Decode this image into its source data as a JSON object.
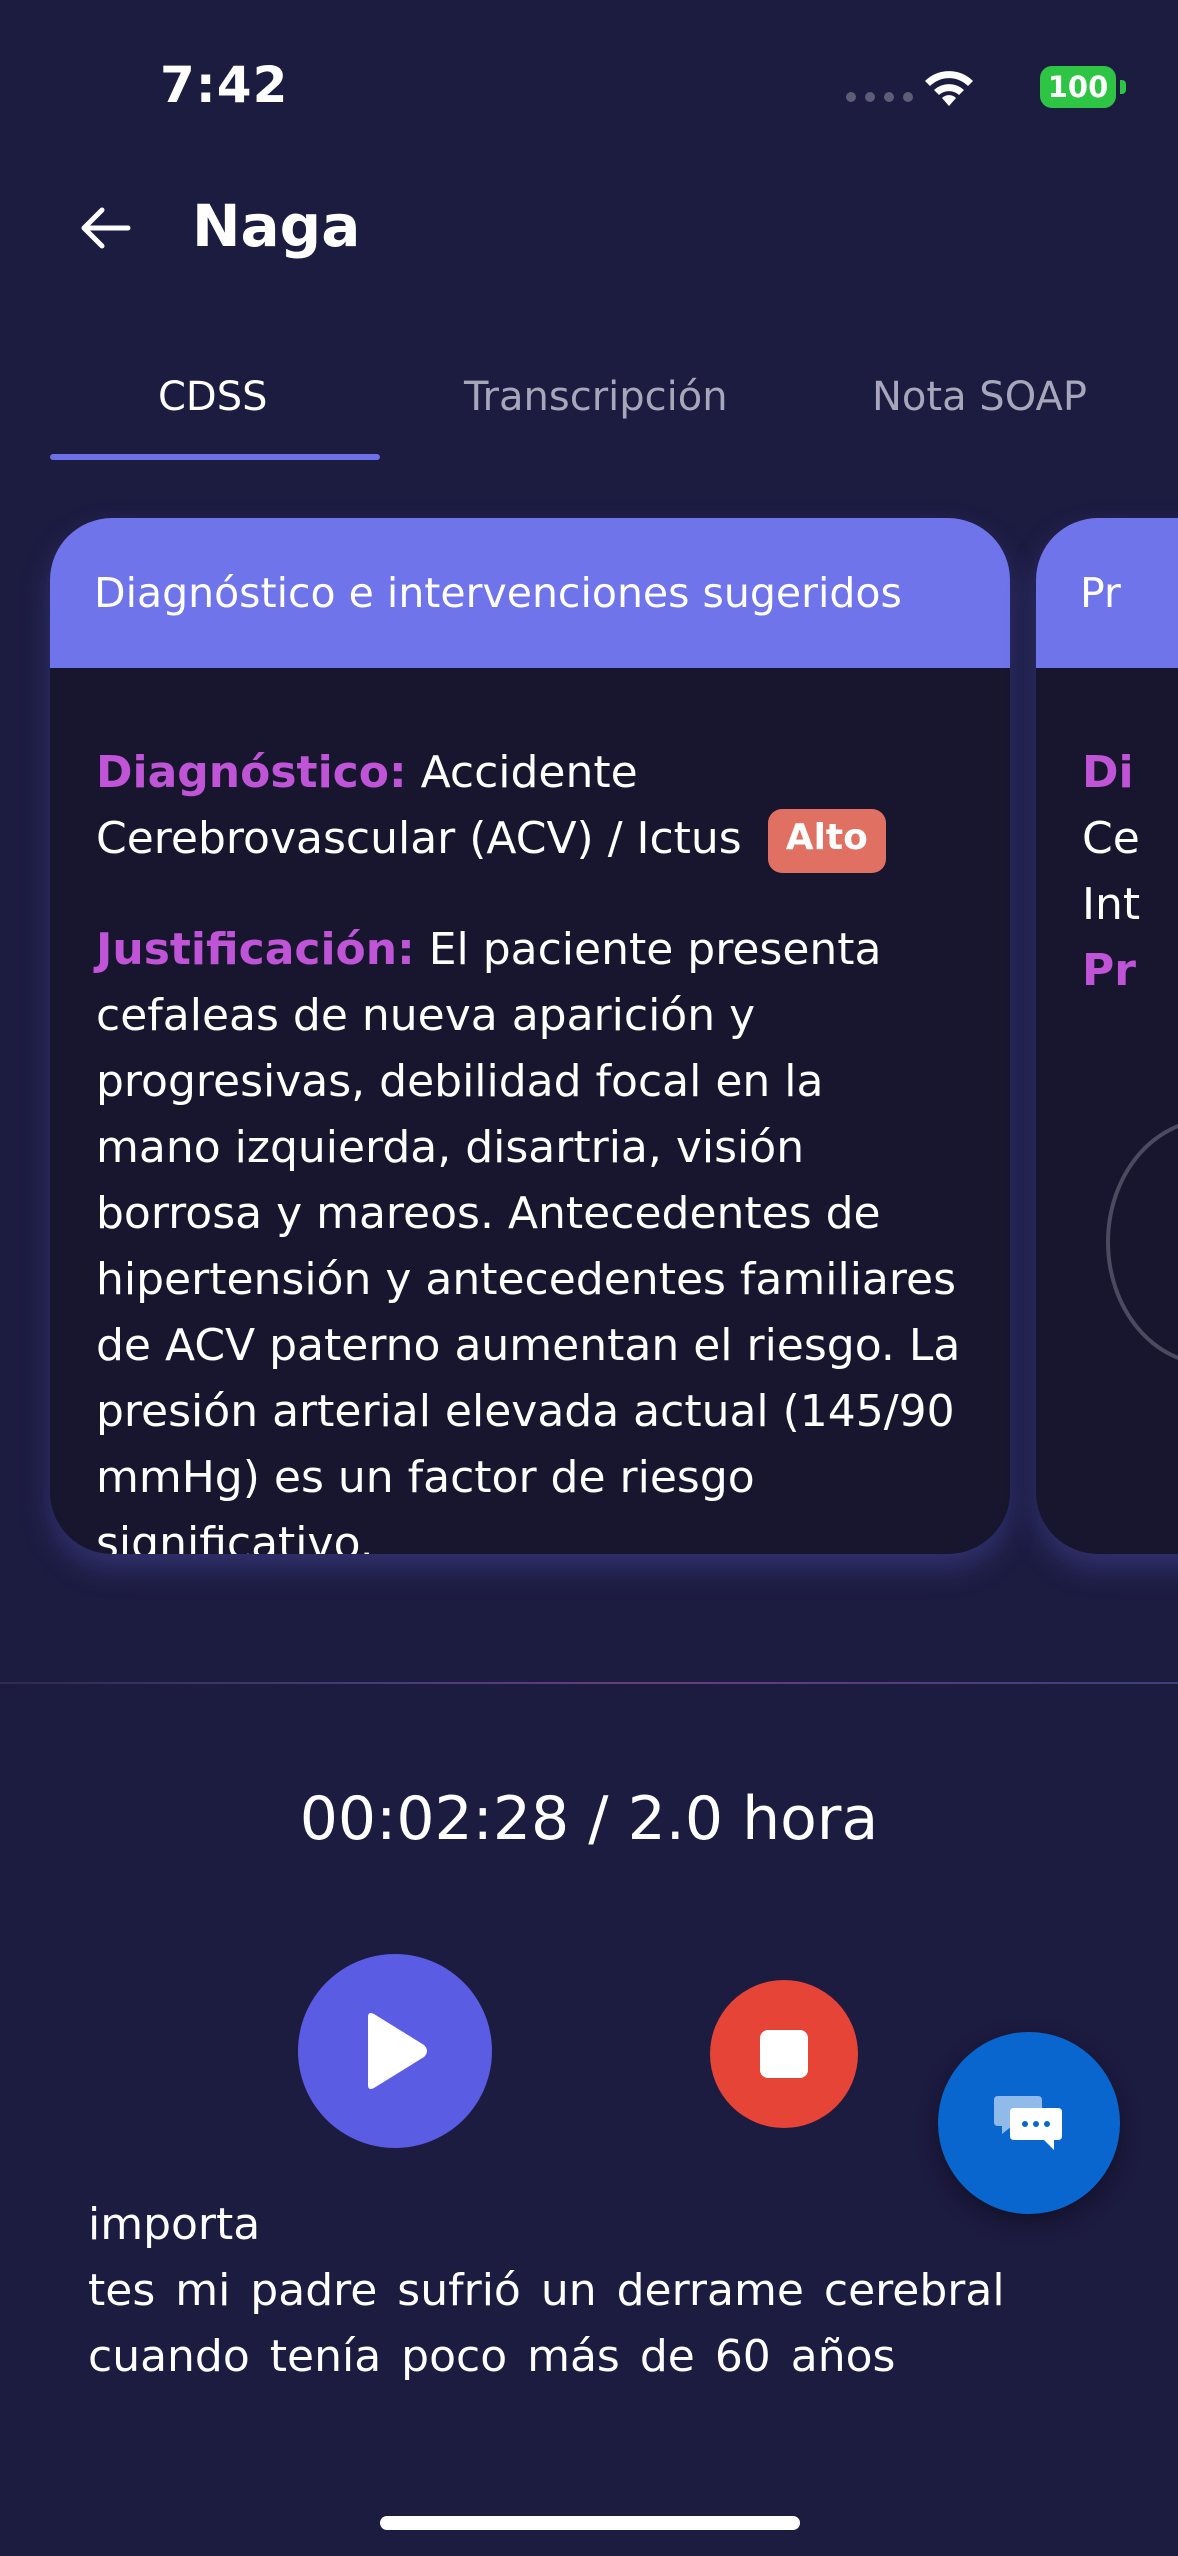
{
  "status_bar": {
    "time": "7:42",
    "battery_level": "100",
    "battery_color": "#2ec444"
  },
  "header": {
    "title": "Naga",
    "back_icon": "arrow-left-icon"
  },
  "tabs": [
    {
      "label": "CDSS",
      "active": true
    },
    {
      "label": "Transcripción",
      "active": false
    },
    {
      "label": "Nota SOAP",
      "active": false
    }
  ],
  "cards": {
    "main": {
      "header": "Diagnóstico e intervenciones sugeridos",
      "diagnosis_label": "Diagnóstico:",
      "diagnosis_value": "Accidente Cerebrovascular (ACV) / Ictus",
      "severity_badge": "Alto",
      "justification_label": "Justificación:",
      "justification_text": "El paciente presenta cefaleas de nueva aparición y progresivas, debilidad focal en la mano izquierda, disartria, visión borrosa y mareos. Antecedentes de hipertensión y antecedentes familiares de ACV paterno aumentan el riesgo. La presión arterial elevada actual (145/90 mmHg) es un factor de riesgo significativo."
    },
    "next": {
      "header": "Pr",
      "line1": "Di",
      "line2": "Ce",
      "line3": "Int",
      "line4": "Pr"
    }
  },
  "player": {
    "timer": "00:02:28 / 2.0 hora",
    "play_icon": "play-icon",
    "stop_icon": "stop-icon",
    "chat_icon": "chat-icon"
  },
  "transcript": {
    "line1": "similar es o problemas de salud importa",
    "line2": "tes mi padre sufrió un derrame cerebral",
    "line3": "cuando tenía poco más de 60 años"
  },
  "colors": {
    "background": "#1c1b40",
    "accent": "#6f74ea",
    "label": "#bf55d6",
    "badge": "#df7062",
    "stop": "#e64437",
    "chat": "#0a66cf"
  }
}
